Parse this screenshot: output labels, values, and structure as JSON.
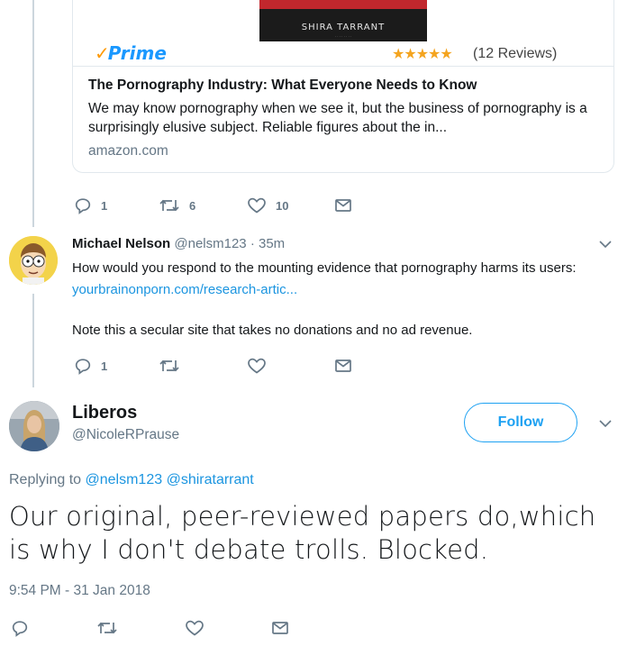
{
  "card": {
    "book_author": "SHIRA TARRANT",
    "prime_label": "Prime",
    "stars": "★★★★★",
    "reviews": "(12 Reviews)",
    "title": "The Pornography Industry: What Everyone Needs to Know",
    "description": "We may know pornography when we see it, but the business of pornography is a surprisingly elusive subject. Reliable figures about the in...",
    "domain": "amazon.com"
  },
  "first_actions": {
    "reply_count": "1",
    "retweet_count": "6",
    "like_count": "10"
  },
  "reply_tweet": {
    "name": "Michael Nelson",
    "handle": "@nelsm123",
    "time": "· 35m",
    "text": "How would you respond to the mounting evidence that pornography harms its users: ",
    "link": "yourbrainonporn.com/research-artic...",
    "note": "Note this a secular site that takes no donations and no ad revenue.",
    "reply_count": "1"
  },
  "main_tweet": {
    "name": "Liberos",
    "handle": "@NicoleRPrause",
    "follow_label": "Follow",
    "replying_prefix": "Replying to",
    "replying_to_1": "@nelsm123",
    "replying_to_2": "@shiratarrant",
    "text": "Our original, peer-reviewed papers do,which is why I don't debate trolls. Blocked.",
    "timestamp": "9:54 PM - 31 Jan 2018"
  },
  "colors": {
    "accent": "#1da1f2",
    "link": "#1b95e0",
    "muted": "#657786",
    "prime_blue": "#1a98ff",
    "star": "#f4a41f"
  }
}
